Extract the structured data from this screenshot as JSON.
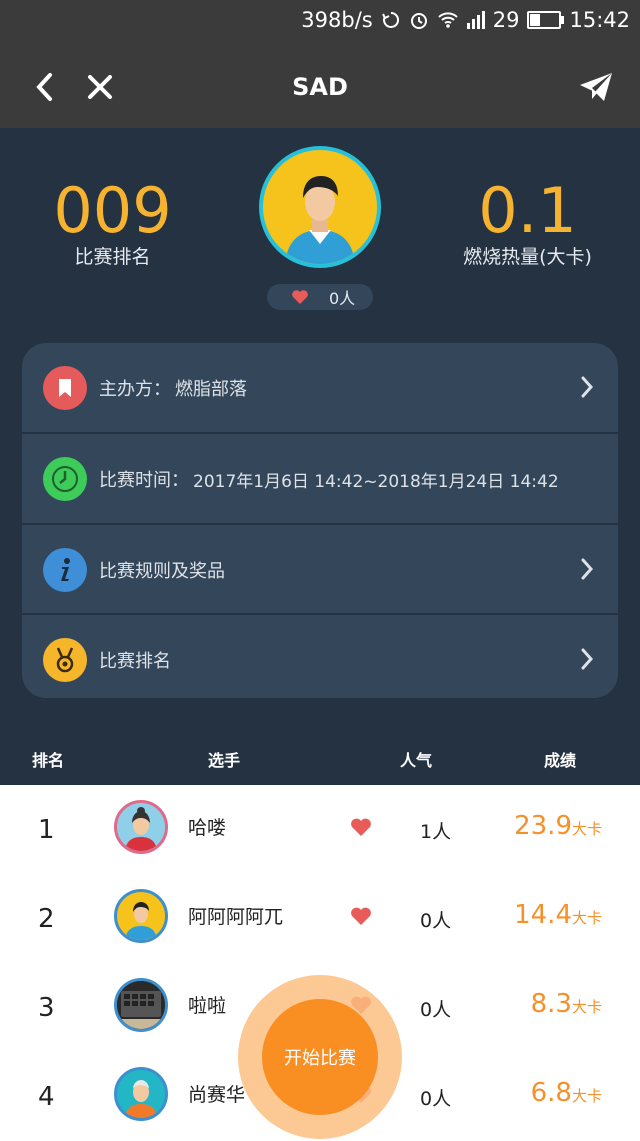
{
  "status_bar": {
    "speed": "398b/s",
    "battery": "29",
    "time": "15:42"
  },
  "nav": {
    "title": "SAD"
  },
  "hero": {
    "rank_value": "009",
    "rank_label": "比赛排名",
    "calorie_value": "0.1",
    "calorie_label": "燃烧热量(大卡)",
    "likes": "0人"
  },
  "info": {
    "organizer_label": "主办方：",
    "organizer_value": "燃脂部落",
    "time_label": "比赛时间：",
    "time_value": "2017年1月6日 14:42~2018年1月24日 14:42",
    "rules_label": "比赛规则及奖品",
    "ranking_label": "比赛排名"
  },
  "table": {
    "headers": [
      "排名",
      "选手",
      "人气",
      "成绩"
    ],
    "rows": [
      {
        "rank": "1",
        "name": "哈喽",
        "popularity": "1人",
        "score": "23.9",
        "unit": "大卡"
      },
      {
        "rank": "2",
        "name": "阿阿阿阿兀",
        "popularity": "0人",
        "score": "14.4",
        "unit": "大卡"
      },
      {
        "rank": "3",
        "name": "啦啦",
        "popularity": "0人",
        "score": "8.3",
        "unit": "大卡"
      },
      {
        "rank": "4",
        "name": "尚赛华",
        "popularity": "0人",
        "score": "6.8",
        "unit": "大卡"
      }
    ]
  },
  "fab": {
    "label": "开始比赛"
  },
  "colors": {
    "accent": "#f98f22",
    "navy": "#243242",
    "gold": "#f5b330"
  }
}
